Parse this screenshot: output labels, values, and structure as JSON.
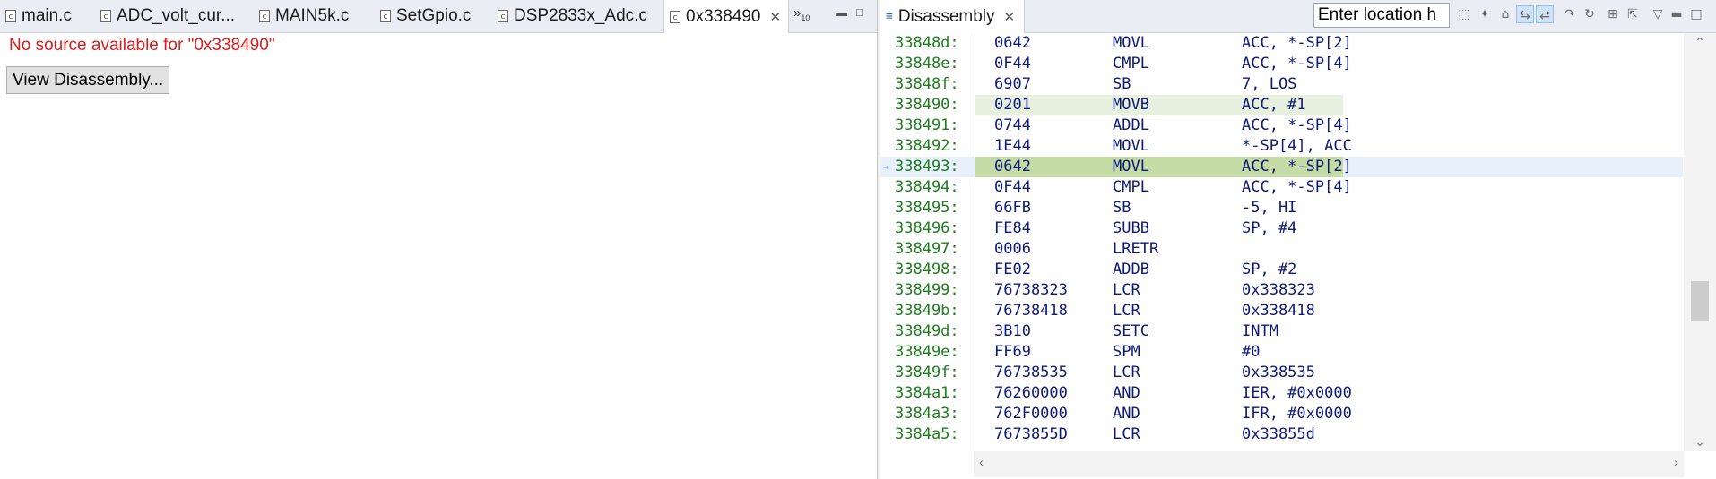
{
  "editor": {
    "tabs": [
      {
        "label": "main.c",
        "icon": "c-file-icon"
      },
      {
        "label": "ADC_volt_cur...",
        "icon": "c-file-icon"
      },
      {
        "label": "MAIN5k.c",
        "icon": "c-file-icon"
      },
      {
        "label": "SetGpio.c",
        "icon": "c-file-icon"
      },
      {
        "label": "DSP2833x_Adc.c",
        "icon": "c-file-icon"
      },
      {
        "label": "0x338490",
        "icon": "c-file-icon"
      }
    ],
    "overflow_count": "10",
    "message": "No source available for \"0x338490\"",
    "view_disassembly_label": "View Disassembly..."
  },
  "disassembly": {
    "tab_label": "Disassembly",
    "location_input_value": "Enter location h",
    "rows": [
      {
        "addr": "33848d:",
        "opcode": "0642",
        "mnemonic": "MOVL",
        "operands": "ACC, *-SP[2]"
      },
      {
        "addr": "33848e:",
        "opcode": "0F44",
        "mnemonic": "CMPL",
        "operands": "ACC, *-SP[4]"
      },
      {
        "addr": "33848f:",
        "opcode": "6907",
        "mnemonic": "SB",
        "operands": "7, LOS"
      },
      {
        "addr": "338490:",
        "opcode": "0201",
        "mnemonic": "MOVB",
        "operands": "ACC, #1"
      },
      {
        "addr": "338491:",
        "opcode": "0744",
        "mnemonic": "ADDL",
        "operands": "ACC, *-SP[4]"
      },
      {
        "addr": "338492:",
        "opcode": "1E44",
        "mnemonic": "MOVL",
        "operands": "*-SP[4], ACC"
      },
      {
        "addr": "338493:",
        "opcode": "0642",
        "mnemonic": "MOVL",
        "operands": "ACC, *-SP[2]"
      },
      {
        "addr": "338494:",
        "opcode": "0F44",
        "mnemonic": "CMPL",
        "operands": "ACC, *-SP[4]"
      },
      {
        "addr": "338495:",
        "opcode": "66FB",
        "mnemonic": "SB",
        "operands": "-5, HI"
      },
      {
        "addr": "338496:",
        "opcode": "FE84",
        "mnemonic": "SUBB",
        "operands": "SP, #4"
      },
      {
        "addr": "338497:",
        "opcode": "0006",
        "mnemonic": "LRETR",
        "operands": ""
      },
      {
        "addr": "338498:",
        "opcode": "FE02",
        "mnemonic": "ADDB",
        "operands": "SP, #2"
      },
      {
        "addr": "338499:",
        "opcode": "76738323",
        "mnemonic": "LCR",
        "operands": "0x338323"
      },
      {
        "addr": "33849b:",
        "opcode": "76738418",
        "mnemonic": "LCR",
        "operands": "0x338418"
      },
      {
        "addr": "33849d:",
        "opcode": "3B10",
        "mnemonic": "SETC",
        "operands": "INTM"
      },
      {
        "addr": "33849e:",
        "opcode": "FF69",
        "mnemonic": "SPM",
        "operands": "#0"
      },
      {
        "addr": "33849f:",
        "opcode": "76738535",
        "mnemonic": "LCR",
        "operands": "0x338535"
      },
      {
        "addr": "3384a1:",
        "opcode": "76260000",
        "mnemonic": "AND",
        "operands": "IER, #0x0000"
      },
      {
        "addr": "3384a3:",
        "opcode": "762F0000",
        "mnemonic": "AND",
        "operands": "IFR, #0x0000"
      },
      {
        "addr": "3384a5:",
        "opcode": "7673855D",
        "mnemonic": "LCR",
        "operands": "0x33855d"
      }
    ],
    "highlight_light_row": 3,
    "highlight_strong_row": 6,
    "pc_row": 6
  },
  "colors": {
    "address": "#1e7e1e",
    "code": "#0e1a7a",
    "error_text": "#e01b1b",
    "highlight_light": "#e7f0df",
    "highlight_strong": "#c5dba6",
    "pc_line": "#e8f1fb"
  }
}
